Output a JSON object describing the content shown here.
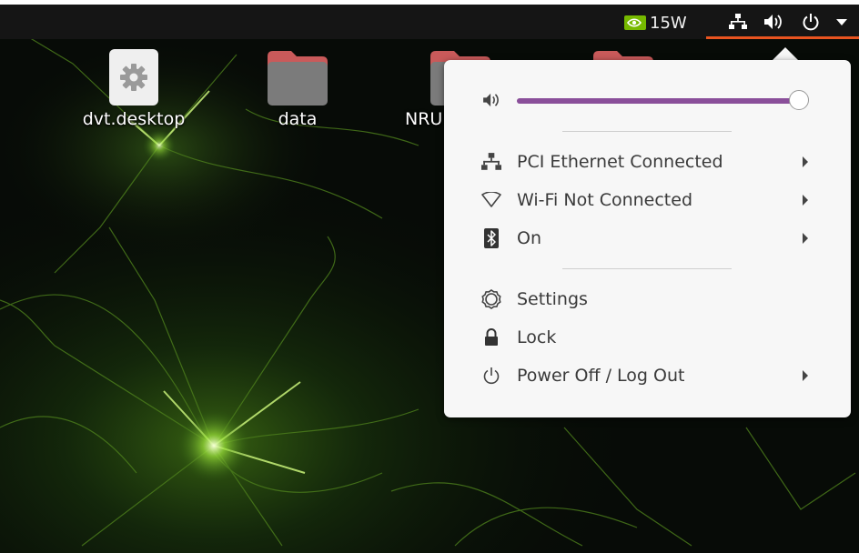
{
  "top_bar": {
    "gpu_power_label": "15W",
    "icons": [
      "nvidia-logo-icon",
      "network-wired-icon",
      "speaker-volume-icon",
      "power-icon",
      "dropdown-arrow-icon"
    ],
    "accent_color": "#e95420"
  },
  "desktop_icons": [
    {
      "label": "dvt.desktop",
      "icon": "gear-icon"
    },
    {
      "label": "data",
      "icon": "folder-icon"
    },
    {
      "label": "NRU",
      "icon": "folder-icon"
    },
    {
      "label": "",
      "icon": "folder-icon"
    }
  ],
  "system_menu": {
    "volume": {
      "level": 0.98,
      "icon": "speaker-volume-icon"
    },
    "network_items": [
      {
        "label": "PCI Ethernet Connected",
        "icon": "network-wired-icon"
      },
      {
        "label": "Wi-Fi Not Connected",
        "icon": "wifi-icon"
      },
      {
        "label": "On",
        "icon": "bluetooth-icon"
      }
    ],
    "action_items": [
      {
        "label": "Settings",
        "icon": "settings-gear-icon"
      },
      {
        "label": "Lock",
        "icon": "lock-icon"
      },
      {
        "label": "Power Off / Log Out",
        "icon": "power-icon"
      }
    ],
    "slider_color": "#8a4f9a"
  }
}
